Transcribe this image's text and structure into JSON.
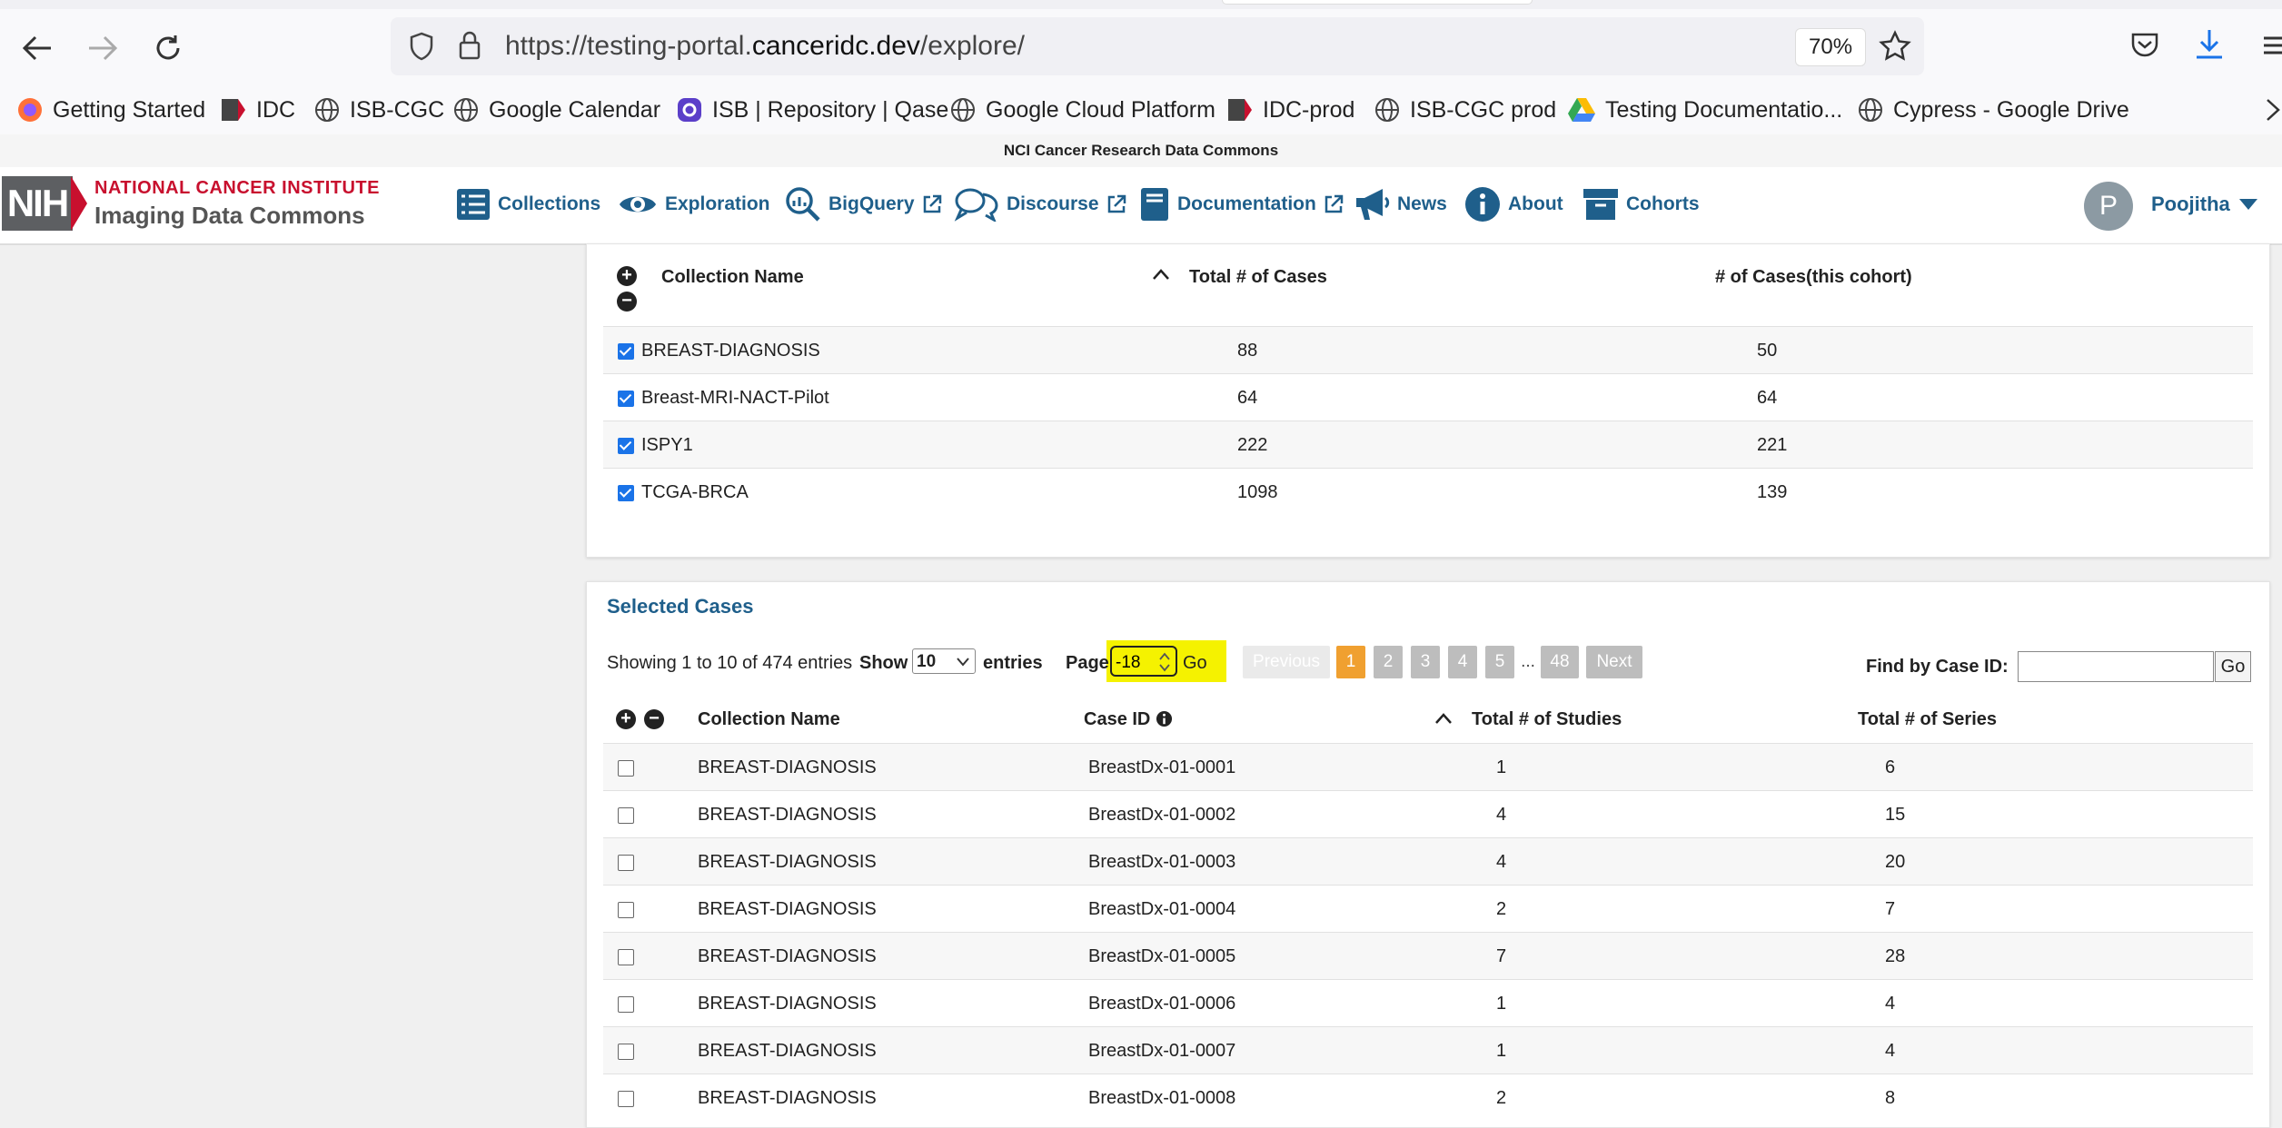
{
  "browser": {
    "url_prefix": "https://testing-portal.",
    "url_host": "canceridc.dev",
    "url_path": "/explore/",
    "zoom": "70%"
  },
  "bookmarks": [
    {
      "label": "Getting Started",
      "icon": "firefox-icon"
    },
    {
      "label": "IDC",
      "icon": "idc-icon"
    },
    {
      "label": "ISB-CGC",
      "icon": "globe-icon"
    },
    {
      "label": "Google Calendar",
      "icon": "globe-icon"
    },
    {
      "label": "ISB | Repository | Qase",
      "icon": "qase-icon"
    },
    {
      "label": "Google Cloud Platform",
      "icon": "globe-icon"
    },
    {
      "label": "IDC-prod",
      "icon": "idc-icon"
    },
    {
      "label": "ISB-CGC prod",
      "icon": "globe-icon"
    },
    {
      "label": "Testing Documentatio...",
      "icon": "google-drive-icon"
    },
    {
      "label": "Cypress - Google Drive",
      "icon": "globe-icon"
    }
  ],
  "nci_strip": "NCI Cancer Research Data Commons",
  "site": {
    "logo_nih": "NIH",
    "logo_nci": "NATIONAL CANCER INSTITUTE",
    "logo_idc": "Imaging Data Commons",
    "nav": [
      {
        "label": "Collections",
        "icon": "list-icon"
      },
      {
        "label": "Exploration",
        "icon": "eye-icon"
      },
      {
        "label": "BigQuery",
        "icon": "magnify-chart-icon",
        "external": true
      },
      {
        "label": "Discourse",
        "icon": "chat-bubbles-icon",
        "external": true
      },
      {
        "label": "Documentation",
        "icon": "book-icon",
        "external": true
      },
      {
        "label": "News",
        "icon": "megaphone-icon"
      },
      {
        "label": "About",
        "icon": "info-icon"
      },
      {
        "label": "Cohorts",
        "icon": "archive-box-icon"
      }
    ],
    "user_initial": "P",
    "user_name": "Poojitha"
  },
  "collections_table": {
    "headers": {
      "name": "Collection Name",
      "total": "Total # of Cases",
      "cohort": "# of Cases(this cohort)"
    },
    "rows": [
      {
        "name": "BREAST-DIAGNOSIS",
        "total": "88",
        "cohort": "50"
      },
      {
        "name": "Breast-MRI-NACT-Pilot",
        "total": "64",
        "cohort": "64"
      },
      {
        "name": "ISPY1",
        "total": "222",
        "cohort": "221"
      },
      {
        "name": "TCGA-BRCA",
        "total": "1098",
        "cohort": "139"
      }
    ]
  },
  "selected_cases": {
    "title": "Selected Cases",
    "showing": "Showing 1 to 10 of 474 entries",
    "show_label": "Show",
    "show_value": "10",
    "entries_label": "entries",
    "page_label": "Page",
    "page_value": "-18",
    "go": "Go",
    "prev": "Previous",
    "next": "Next",
    "pages": [
      "1",
      "2",
      "3",
      "4",
      "5"
    ],
    "ellipsis": "...",
    "last_page": "48",
    "find_label": "Find by Case ID:",
    "find_value": "",
    "find_go": "Go",
    "headers": {
      "collection": "Collection Name",
      "case": "Case ID",
      "studies": "Total # of Studies",
      "series": "Total # of Series"
    },
    "rows": [
      {
        "collection": "BREAST-DIAGNOSIS",
        "case": "BreastDx-01-0001",
        "studies": "1",
        "series": "6"
      },
      {
        "collection": "BREAST-DIAGNOSIS",
        "case": "BreastDx-01-0002",
        "studies": "4",
        "series": "15"
      },
      {
        "collection": "BREAST-DIAGNOSIS",
        "case": "BreastDx-01-0003",
        "studies": "4",
        "series": "20"
      },
      {
        "collection": "BREAST-DIAGNOSIS",
        "case": "BreastDx-01-0004",
        "studies": "2",
        "series": "7"
      },
      {
        "collection": "BREAST-DIAGNOSIS",
        "case": "BreastDx-01-0005",
        "studies": "7",
        "series": "28"
      },
      {
        "collection": "BREAST-DIAGNOSIS",
        "case": "BreastDx-01-0006",
        "studies": "1",
        "series": "4"
      },
      {
        "collection": "BREAST-DIAGNOSIS",
        "case": "BreastDx-01-0007",
        "studies": "1",
        "series": "4"
      },
      {
        "collection": "BREAST-DIAGNOSIS",
        "case": "BreastDx-01-0008",
        "studies": "2",
        "series": "8"
      }
    ]
  }
}
